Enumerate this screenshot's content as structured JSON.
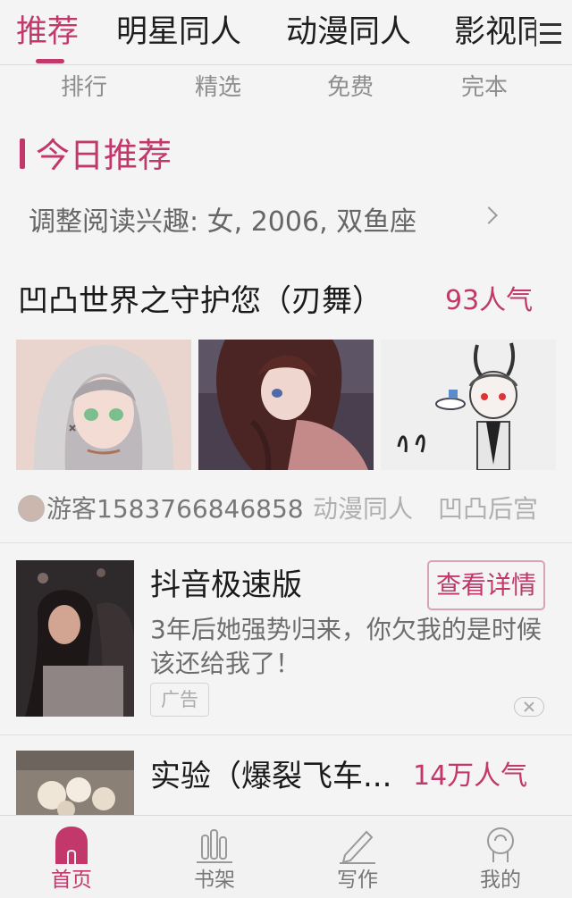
{
  "top_tabs": [
    {
      "label": "推荐",
      "active": true
    },
    {
      "label": "明星同人"
    },
    {
      "label": "动漫同人"
    },
    {
      "label": "影视同"
    }
  ],
  "sub_tabs": [
    "排行",
    "精选",
    "免费",
    "完本"
  ],
  "section": {
    "title": "今日推荐"
  },
  "interest": {
    "label": "调整阅读兴趣: 女, 2006, 双鱼座"
  },
  "book1": {
    "title": "凹凸世界之守护您（刃舞）",
    "popularity": "93人气",
    "author": "游客1583766846858",
    "tags": [
      "动漫同人",
      "凹凸后宫"
    ]
  },
  "ad": {
    "title": "抖音极速版",
    "button_label": "查看详情",
    "description": "3年后她强势归来，你欠我的是时候该还给我了！",
    "label": "广告"
  },
  "book2": {
    "title": "实验（爆裂飞车...",
    "popularity": "14万人气"
  },
  "bottom_nav": [
    {
      "label": "首页",
      "icon": "home-icon",
      "active": true
    },
    {
      "label": "书架",
      "icon": "bookshelf-icon"
    },
    {
      "label": "写作",
      "icon": "pen-icon"
    },
    {
      "label": "我的",
      "icon": "profile-icon"
    }
  ],
  "colors": {
    "accent": "#c2386a",
    "background": "#f4f4f4"
  }
}
